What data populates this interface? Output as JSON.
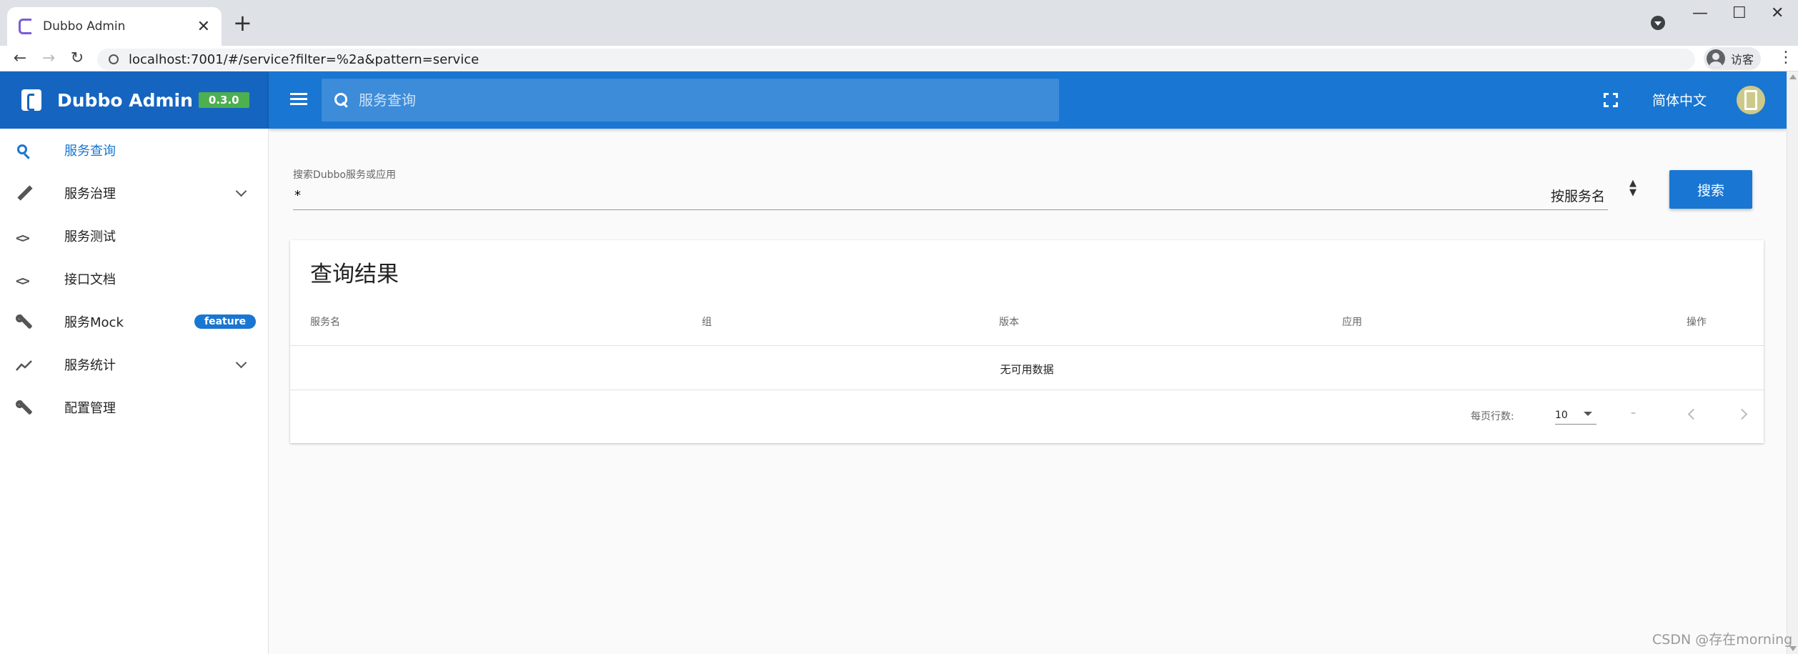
{
  "browser": {
    "tab_title": "Dubbo Admin",
    "url": "localhost:7001/#/service?filter=%2a&pattern=service",
    "profile_label": "访客"
  },
  "header": {
    "app_title": "Dubbo Admin",
    "version": "0.3.0",
    "search_placeholder": "服务查询",
    "language": "简体中文"
  },
  "sidebar": {
    "items": [
      {
        "label": "服务查询",
        "icon": "search-icon",
        "active": true
      },
      {
        "label": "服务治理",
        "icon": "pencil-icon",
        "expandable": true
      },
      {
        "label": "服务测试",
        "icon": "code-icon"
      },
      {
        "label": "接口文档",
        "icon": "code-icon"
      },
      {
        "label": "服务Mock",
        "icon": "wrench-icon",
        "badge": "feature"
      },
      {
        "label": "服务统计",
        "icon": "trending-icon",
        "expandable": true
      },
      {
        "label": "配置管理",
        "icon": "wrench-icon"
      }
    ]
  },
  "search": {
    "label": "搜索Dubbo服务或应用",
    "value": "*",
    "type": "按服务名",
    "button": "搜索"
  },
  "results": {
    "title": "查询结果",
    "columns": [
      "服务名",
      "组",
      "版本",
      "应用",
      "操作"
    ],
    "empty_text": "无可用数据",
    "rows_per_page_label": "每页行数:",
    "rows_per_page": "10",
    "range": "–"
  },
  "watermark": "CSDN @存在morning",
  "colors": {
    "primary": "#1976d2",
    "header_left": "#1565c0",
    "version_badge": "#4caf50"
  }
}
